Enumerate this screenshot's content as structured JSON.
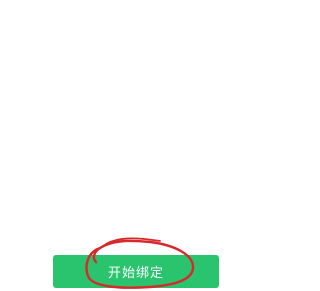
{
  "page": {
    "background_color": "#ffffff"
  },
  "bind_button": {
    "label": "开始绑定",
    "background_color": "#2ac46f",
    "text_color": "#ffffff"
  },
  "annotation": {
    "shape": "hand-drawn-circle",
    "color": "#d9282a"
  }
}
